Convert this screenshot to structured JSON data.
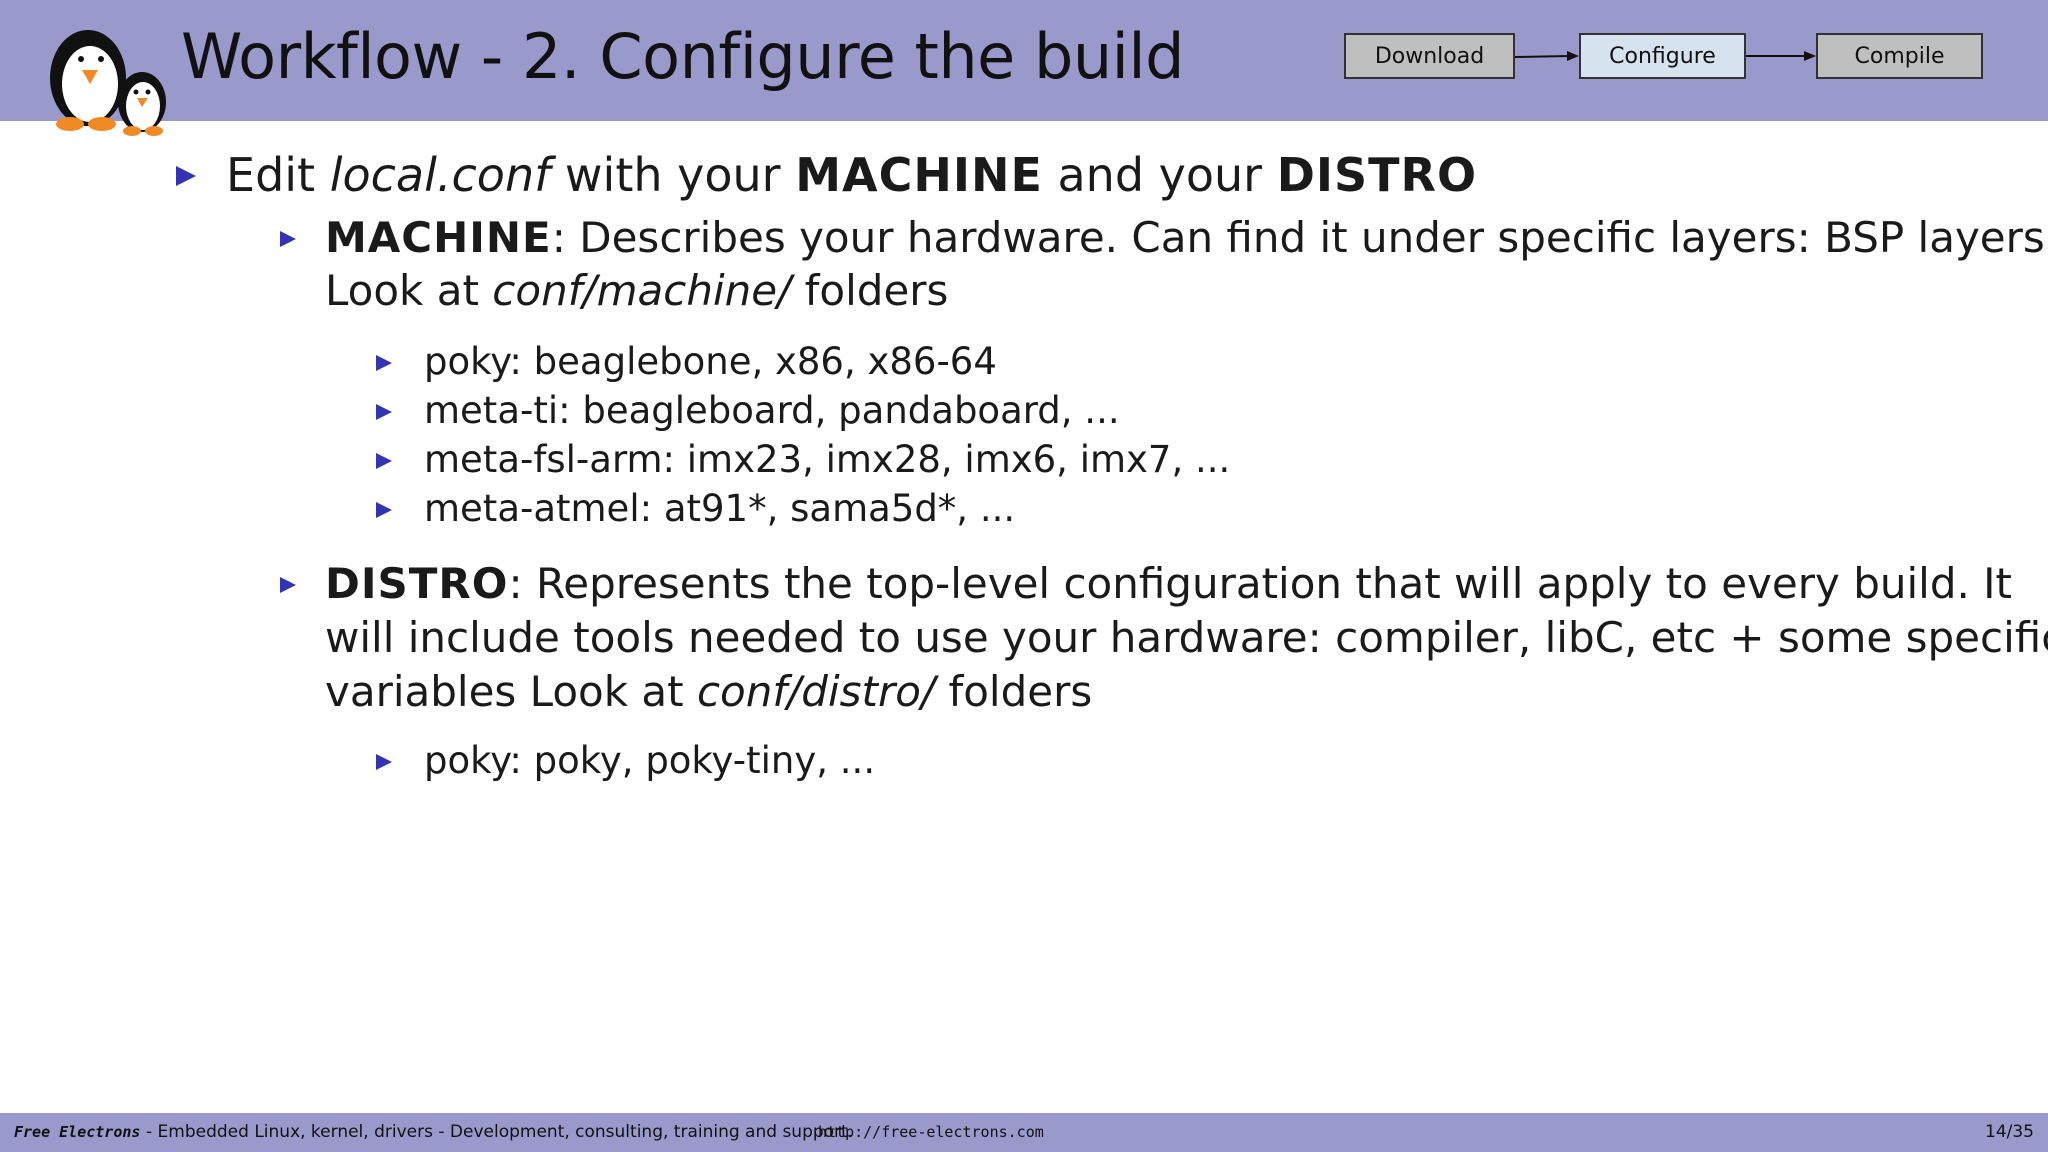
{
  "header": {
    "title": "Workflow - 2.  Configure the build",
    "workflow_steps": [
      {
        "label": "Download",
        "state": "inactive"
      },
      {
        "label": "Configure",
        "state": "active"
      },
      {
        "label": "Compile",
        "state": "inactive"
      }
    ],
    "logo_icon": "penguins-logo-icon"
  },
  "content": {
    "item1": {
      "prefix": "Edit ",
      "file": "local.conf",
      "mid": " with your ",
      "machine": "MACHINE",
      "and": " and your ",
      "distro": "DISTRO"
    },
    "machine": {
      "term": "MACHINE",
      "line1_rest": ": Describes your hardware.  Can find it under specific layers: BSP layers.",
      "line2_prefix": "Look at ",
      "line2_path": "conf/machine/",
      "line2_suffix": " folders",
      "examples": [
        "poky:  beaglebone, x86, x86-64",
        "meta-ti:  beagleboard, pandaboard, ...",
        "meta-fsl-arm:  imx23, imx28, imx6, imx7, ...",
        "meta-atmel:  at91*, sama5d*, ..."
      ]
    },
    "distro": {
      "term": "DISTRO",
      "line1_rest": ": Represents the top-level configuration that will apply to every build.  It",
      "line2": "will include tools needed to use your hardware: compiler, libC, etc + some specific",
      "line3_prefix": "variables Look at ",
      "line3_path": "conf/distro/",
      "line3_suffix": " folders",
      "examples": [
        "poky:  poky, poky-tiny, ..."
      ]
    }
  },
  "footer": {
    "brand": "Free Electrons",
    "tagline": "- Embedded Linux, kernel, drivers - Development, consulting, training and support.",
    "url": "http://free-electrons.com",
    "page": "14/35"
  },
  "colors": {
    "header_bg": "#9999cc",
    "bullet": "#3333b3",
    "active_step": "#d6e2ee",
    "inactive_step": "#bfbfbf"
  }
}
